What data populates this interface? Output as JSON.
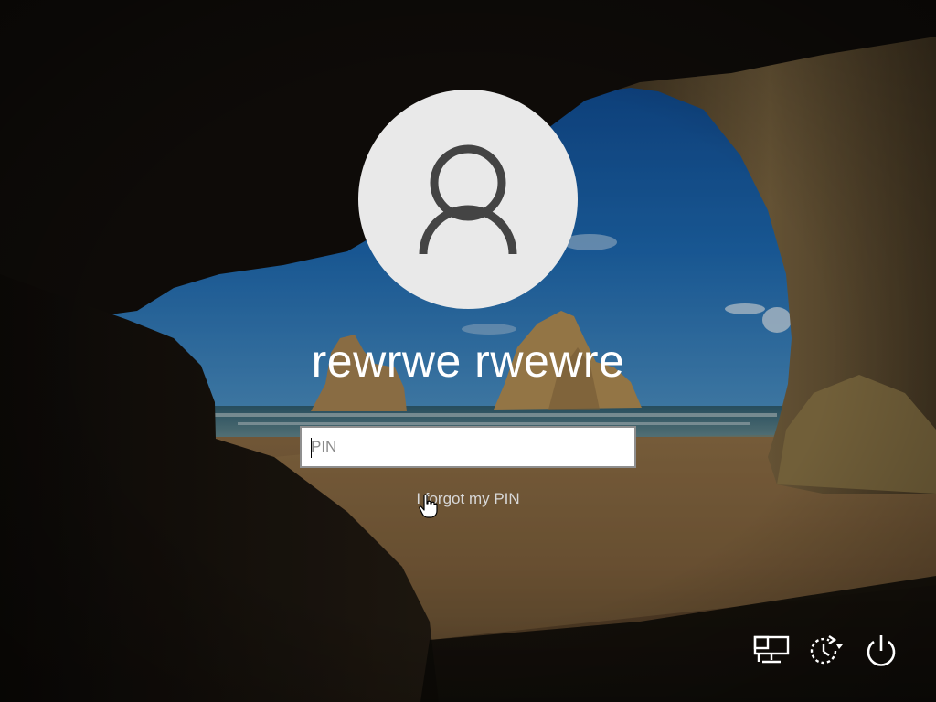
{
  "user": {
    "display_name": "rewrwe rwewre"
  },
  "pin_input": {
    "placeholder": "PIN",
    "value": ""
  },
  "links": {
    "forgot_pin": "I forgot my PIN"
  },
  "tray": {
    "icons": [
      "network-icon",
      "ease-of-access-icon",
      "power-icon"
    ]
  },
  "colors": {
    "avatar_bg": "#e9e9e9",
    "avatar_glyph": "#444444",
    "text": "#ffffff",
    "link": "#d8d8d8"
  }
}
